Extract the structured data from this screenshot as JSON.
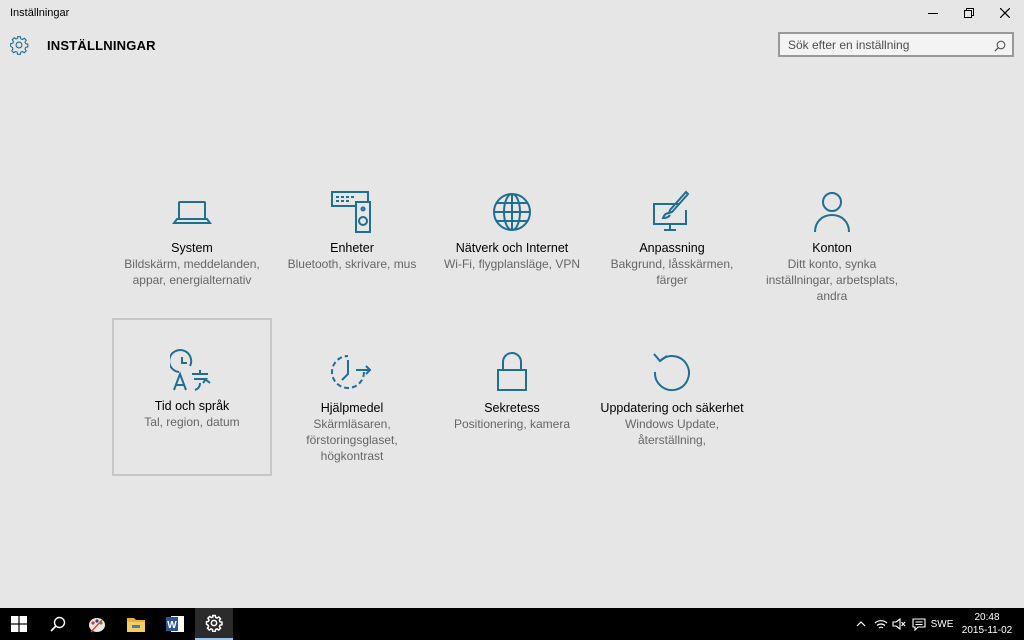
{
  "window": {
    "title": "Inställningar",
    "minimize_icon": "minimize-icon",
    "restore_icon": "restore-icon",
    "close_icon": "close-icon"
  },
  "header": {
    "icon": "gear-icon",
    "title": "INSTÄLLNINGAR"
  },
  "search": {
    "placeholder": "Sök efter en inställning",
    "value": "",
    "icon": "search-icon"
  },
  "accent_color": "#1f6f93",
  "categories": [
    {
      "name": "System",
      "desc": "Bildskärm, meddelanden, appar, energialternativ",
      "icon": "laptop-icon"
    },
    {
      "name": "Enheter",
      "desc": "Bluetooth, skrivare, mus",
      "icon": "keyboard-speaker-icon"
    },
    {
      "name": "Nätverk och Internet",
      "desc": "Wi-Fi, flygplansläge, VPN",
      "icon": "globe-icon"
    },
    {
      "name": "Anpassning",
      "desc": "Bakgrund, låsskärmen, färger",
      "icon": "paint-brush-icon"
    },
    {
      "name": "Konton",
      "desc": "Ditt konto, synka inställningar, arbetsplats, andra",
      "icon": "person-icon"
    },
    {
      "name": "Tid och språk",
      "desc": "Tal, region, datum",
      "icon": "clock-language-icon",
      "selected": true
    },
    {
      "name": "Hjälpmedel",
      "desc": "Skärmläsaren, förstoringsglaset, högkontrast",
      "icon": "ease-of-access-icon"
    },
    {
      "name": "Sekretess",
      "desc": "Positionering, kamera",
      "icon": "padlock-icon"
    },
    {
      "name": "Uppdatering och säkerhet",
      "desc": "Windows Update, återställning,",
      "icon": "refresh-icon"
    }
  ],
  "taskbar": {
    "items": [
      {
        "name": "start",
        "icon": "windows-logo-icon"
      },
      {
        "name": "search",
        "icon": "search-icon"
      },
      {
        "name": "paint",
        "icon": "paint-app-icon"
      },
      {
        "name": "file-explorer",
        "icon": "folder-icon"
      },
      {
        "name": "word",
        "icon": "word-app-icon"
      },
      {
        "name": "settings",
        "icon": "gear-icon",
        "active": true
      }
    ],
    "tray": {
      "chevron_icon": "chevron-up-icon",
      "wifi_icon": "wifi-icon",
      "volume_icon": "volume-muted-icon",
      "notification_icon": "action-center-icon",
      "language": "SWE",
      "time": "20:48",
      "date": "2015-11-02"
    }
  }
}
